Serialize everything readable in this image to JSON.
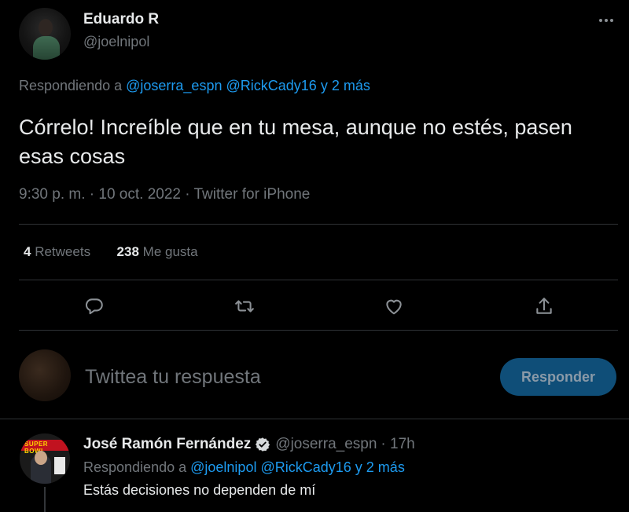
{
  "tweet": {
    "author_name": "Eduardo R",
    "author_handle": "@joelnipol",
    "replying_prefix": "Respondiendo a",
    "replying_to_1": "@joserra_espn",
    "replying_to_2": "@RickCady16",
    "replying_more": "y 2 más",
    "text": "Córrelo! Increíble que en tu mesa, aunque no estés, pasen esas cosas",
    "meta": "9:30 p. m. · 10 oct. 2022 · Twitter for iPhone",
    "retweets_count": "4",
    "retweets_label": "Retweets",
    "likes_count": "238",
    "likes_label": "Me gusta"
  },
  "actions": {
    "reply_icon": "comment-icon",
    "retweet_icon": "retweet-icon",
    "like_icon": "heart-icon",
    "share_icon": "share-icon"
  },
  "composer": {
    "placeholder": "Twittea tu respuesta",
    "button_label": "Responder"
  },
  "reply": {
    "author_name": "José Ramón Fernández",
    "author_handle": "@joserra_espn",
    "time": "· 17h",
    "replying_prefix": "Respondiendo a",
    "replying_to_1": "@joelnipol",
    "replying_to_2": "@RickCady16",
    "replying_more": "y 2 más",
    "text": "Estás decisiones no dependen de mí",
    "avatar_banner_text": "SUPER BOWL"
  },
  "colors": {
    "background": "#000000",
    "accent": "#1d9bf0",
    "muted": "#71767b",
    "button_bg": "#0f4e78"
  }
}
